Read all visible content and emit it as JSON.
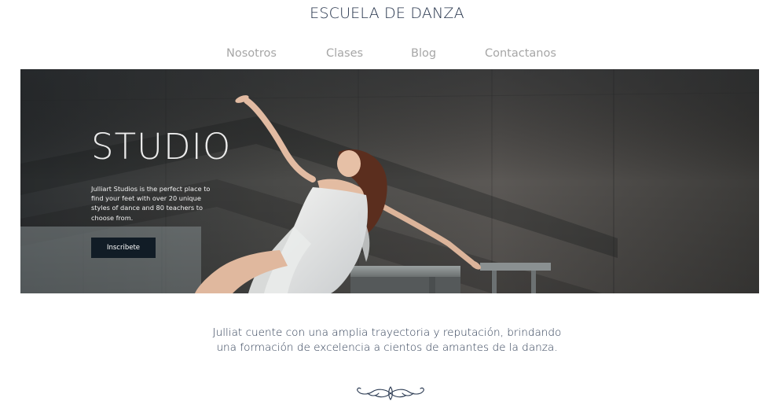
{
  "site": {
    "title": "ESCUELA DE DANZA"
  },
  "nav": {
    "items": [
      {
        "label": "Nosotros"
      },
      {
        "label": "Clases"
      },
      {
        "label": "Blog"
      },
      {
        "label": "Contactanos"
      }
    ]
  },
  "hero": {
    "heading": "STUDIO",
    "text": "Julliart Studios is the perfect place to find your feet with over 20 unique styles of dance and 80 teachers to choose from.",
    "button_label": "Inscribete",
    "image_icon": "dancer-photo"
  },
  "intro": {
    "line1": "Julliat cuente con una amplia trayectoria y reputación, brindando",
    "line2": "una formación de excelencia a cientos de amantes de la danza."
  },
  "ornament": {
    "icon": "flourish-divider-icon"
  },
  "colors": {
    "title": "#24324a",
    "nav": "#a6a6a6",
    "button_bg": "#111c26",
    "body_text": "#2b3a52"
  }
}
